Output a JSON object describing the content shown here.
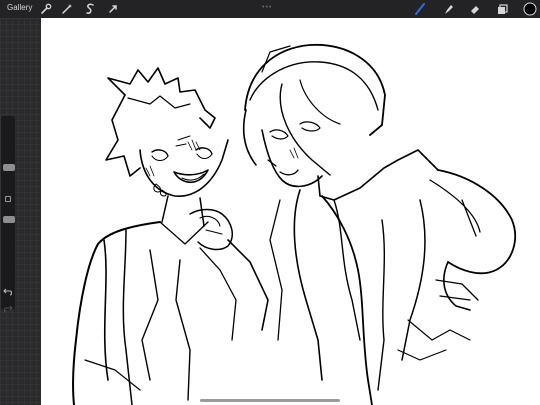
{
  "toolbar": {
    "gallery_label": "Gallery",
    "left_tools": [
      "wrench-icon",
      "magic-wand-icon",
      "selection-icon",
      "transform-icon"
    ],
    "right_tools": [
      "brush-icon",
      "smudge-icon",
      "eraser-icon",
      "layers-icon",
      "color-icon"
    ],
    "active_tool": "brush-icon",
    "brush_color": "#2f6fd6",
    "current_color": "#000000"
  },
  "sidebar": {
    "brush_size_level": 0.25,
    "brush_opacity_level": 0.5,
    "undo_icon": "undo-icon",
    "redo_icon": "redo-icon"
  },
  "canvas": {
    "background": "#ffffff",
    "content": "sketch-drawing"
  }
}
